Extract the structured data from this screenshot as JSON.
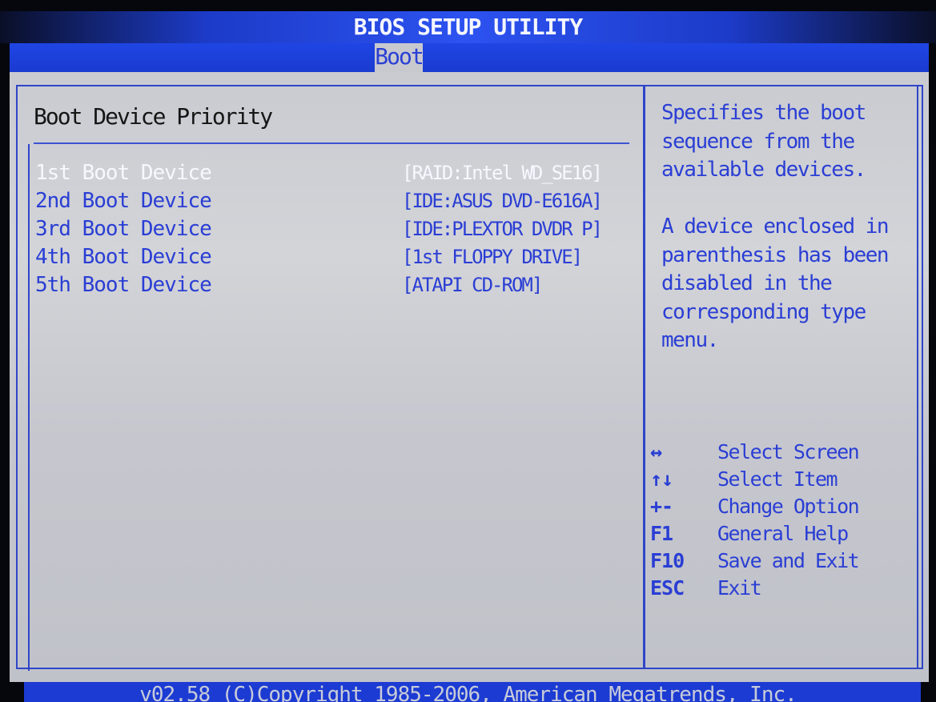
{
  "header": {
    "title": "BIOS SETUP UTILITY"
  },
  "menu": {
    "tabs": [
      "Boot"
    ]
  },
  "main": {
    "section_title": "Boot Device Priority",
    "items": [
      {
        "label": "1st Boot Device",
        "value": "[RAID:Intel WD_SE16]",
        "selected": true
      },
      {
        "label": "2nd Boot Device",
        "value": "[IDE:ASUS DVD-E616A]",
        "selected": false
      },
      {
        "label": "3rd Boot Device",
        "value": "[IDE:PLEXTOR DVDR P]",
        "selected": false
      },
      {
        "label": "4th Boot Device",
        "value": "[1st FLOPPY DRIVE]",
        "selected": false
      },
      {
        "label": "5th Boot Device",
        "value": "[ATAPI CD-ROM]",
        "selected": false
      }
    ]
  },
  "help": {
    "lines": [
      "Specifies the boot",
      "sequence from the",
      "available devices.",
      "",
      "A device enclosed in",
      "parenthesis has been",
      "disabled in the",
      "corresponding type",
      "menu."
    ],
    "keys": [
      {
        "key": "↔",
        "action": "Select Screen"
      },
      {
        "key": "↑↓",
        "action": "Select Item"
      },
      {
        "key": "+-",
        "action": "Change Option"
      },
      {
        "key": "F1",
        "action": "General Help"
      },
      {
        "key": "F10",
        "action": "Save and Exit"
      },
      {
        "key": "ESC",
        "action": "Exit"
      }
    ]
  },
  "footer": {
    "text": "v02.58 (C)Copyright 1985-2006, American Megatrends, Inc."
  },
  "colors": {
    "accent": "#2a3ed4",
    "band": "#1f45e4",
    "panel": "#c9cbd1",
    "selected_text": "#f7f8ff"
  }
}
